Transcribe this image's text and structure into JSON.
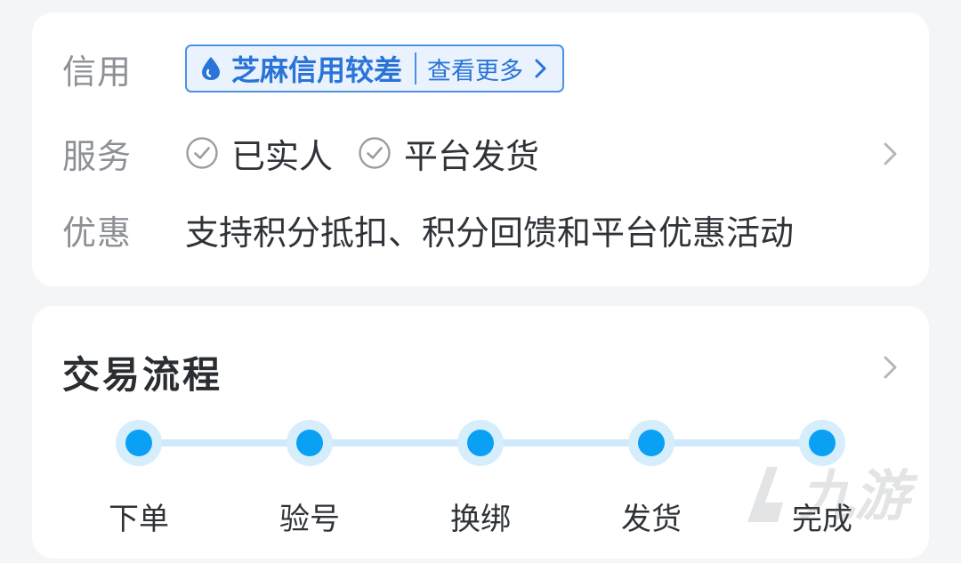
{
  "info": {
    "credit": {
      "label": "信用",
      "tag_main": "芝麻信用较差",
      "tag_more": "查看更多"
    },
    "service": {
      "label": "服务",
      "items": [
        "已实人",
        "平台发货"
      ]
    },
    "promo": {
      "label": "优惠",
      "text": "支持积分抵扣、积分回馈和平台优惠活动"
    }
  },
  "process": {
    "title": "交易流程",
    "steps": [
      "下单",
      "验号",
      "换绑",
      "发货",
      "完成"
    ]
  },
  "watermark": {
    "text": "九游"
  },
  "colors": {
    "accent_blue": "#2a74d8",
    "step_blue": "#0aa1f5",
    "label_gray": "#8d9096",
    "text_dark": "#2f3338"
  },
  "icons": {
    "credit": "water-drop-icon",
    "service_check": "check-circle-icon",
    "chevron": "chevron-right-icon"
  }
}
